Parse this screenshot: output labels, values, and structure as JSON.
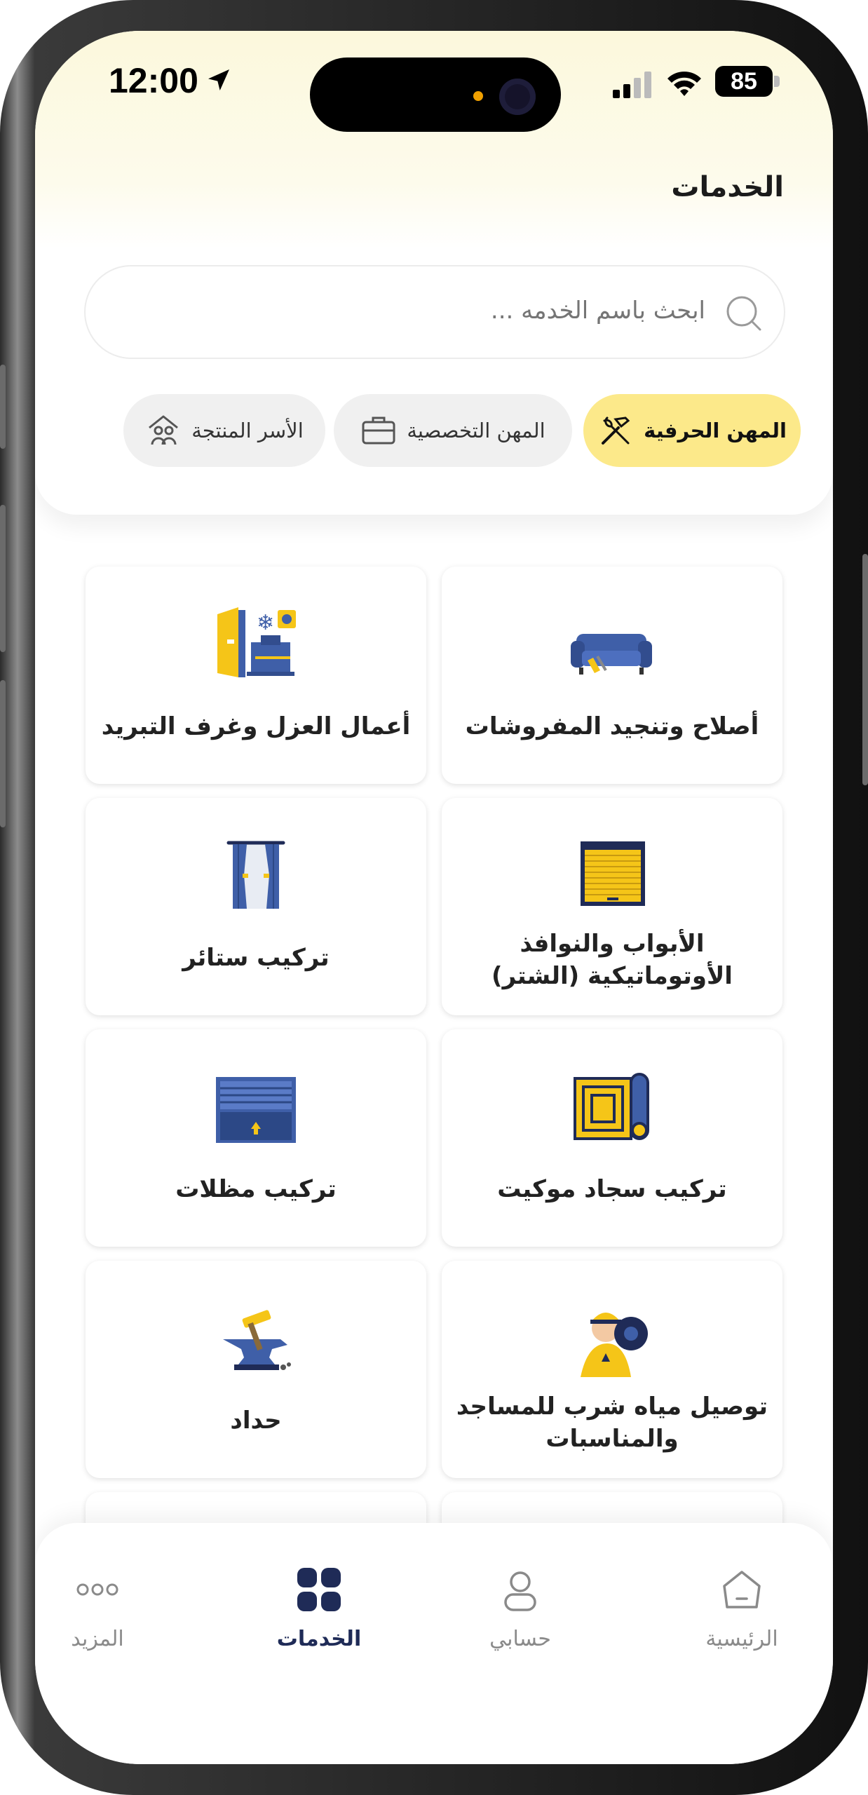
{
  "status_bar": {
    "time": "12:00",
    "battery": "85"
  },
  "page": {
    "title": "الخدمات"
  },
  "search": {
    "placeholder": "ابحث باسم الخدمه ..."
  },
  "filters": [
    {
      "label": "المهن الحرفية",
      "icon": "tools-icon",
      "active": true
    },
    {
      "label": "المهن التخصصية",
      "icon": "briefcase-icon",
      "active": false
    },
    {
      "label": "الأسر المنتجة",
      "icon": "family-home-icon",
      "active": false
    }
  ],
  "services": [
    {
      "label": "أصلاح وتنجيد المفروشات",
      "icon": "sofa-upholstery-icon"
    },
    {
      "label": "أعمال العزل وغرف التبريد",
      "icon": "insulation-cold-room-icon"
    },
    {
      "label": "الأبواب والنوافذ الأوتوماتيكية (الشتر)",
      "icon": "roller-shutter-icon"
    },
    {
      "label": "تركيب ستائر",
      "icon": "curtains-icon"
    },
    {
      "label": "تركيب سجاد موكيت",
      "icon": "carpet-roll-icon"
    },
    {
      "label": "تركيب مظلات",
      "icon": "awning-icon"
    },
    {
      "label": "توصيل مياه شرب للمساجد والمناسبات",
      "icon": "water-delivery-icon"
    },
    {
      "label": "حداد",
      "icon": "anvil-hammer-icon"
    }
  ],
  "bottom_nav": [
    {
      "label": "الرئيسية",
      "icon": "home-icon",
      "active": false
    },
    {
      "label": "حسابي",
      "icon": "user-icon",
      "active": false
    },
    {
      "label": "الخدمات",
      "icon": "grid-icon",
      "active": true
    },
    {
      "label": "المزيد",
      "icon": "more-dots-icon",
      "active": false
    }
  ],
  "colors": {
    "accent": "#fce98a",
    "navy": "#1f2b57",
    "gold": "#f5c518",
    "blue": "#3f5fa8"
  }
}
